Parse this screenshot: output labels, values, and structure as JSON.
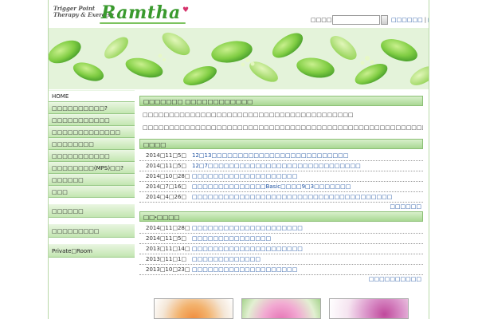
{
  "header": {
    "logo_sub_line1": "Trigger Point",
    "logo_sub_line2": "Therapy & Exercise",
    "logo_main": "Ramtha",
    "search_label": "□□□□□□",
    "search_value": "",
    "links": [
      "□□□□□□",
      "□□□□"
    ]
  },
  "sidebar": {
    "items": [
      "HOME",
      "□□□□□□□□□□?",
      "□□□□□□□□□□□",
      "□□□□□□□□□□□□□",
      "□□□□□□□□",
      "□□□□□□□□□□□",
      "□□□□□□□□(MPS)□□?",
      "□□□□□□",
      "□□□",
      "□□□□□□",
      "□□□□□□□□□",
      "Private□Room"
    ]
  },
  "intro": {
    "heading": "□□□□□□□ □□□□□□□□□□□□",
    "line1": "□□□□□□□□□□□□□□□□□□□□□□□□□□□□□□□□□□□□□□□□",
    "line2": "□□□□□□□□□□□□□□□□□□□□□□□□□□□□□□□□□□□□□□□□□□□□□□□□□□□□□□□□□□□□□"
  },
  "news": {
    "heading": "□□□□",
    "rows": [
      {
        "date": "2014□11□5□",
        "title": "12□13□□□□□□□□□□□□□□□□□□□□□□□□□□"
      },
      {
        "date": "2014□11□5□",
        "title": "12□7□□□□□□□□□□□□□□□□□□□□□□□□□□□□□"
      },
      {
        "date": "2014□10□28□",
        "title": "□□□□□□□□□□□□□□□□□□□□"
      },
      {
        "date": "2014□7□16□",
        "title": "□□□□□□□□□□□□□□Basic□□□□9□3□□□□□□□"
      },
      {
        "date": "2014□4□26□",
        "title": "□□□□□□□□□□□□□□□□□□□□□□□□□□□□□□□□□□□□□□"
      }
    ],
    "more": "□□□□□□"
  },
  "blog": {
    "heading": "□□·□□□□",
    "rows": [
      {
        "date": "2014□11□28□",
        "title": "□□□□□□□□□□□□□□□□□□□□□"
      },
      {
        "date": "2014□11□5□",
        "title": "□□□□□□□□□□□□□□□"
      },
      {
        "date": "2013□11□14□",
        "title": "□□□□□□□□□□□□□□□□□□□□□"
      },
      {
        "date": "2013□11□1□",
        "title": "□□□□□□□□□□□□□"
      },
      {
        "date": "2013□10□23□",
        "title": "□□□□□□□□□□□□□□□□□□□□"
      }
    ],
    "more": "□□□□□□□□□□"
  },
  "colors": {
    "accent_green": "#3a9a2e",
    "link_blue": "#1a4fa0",
    "heart_pink": "#d6336c"
  }
}
